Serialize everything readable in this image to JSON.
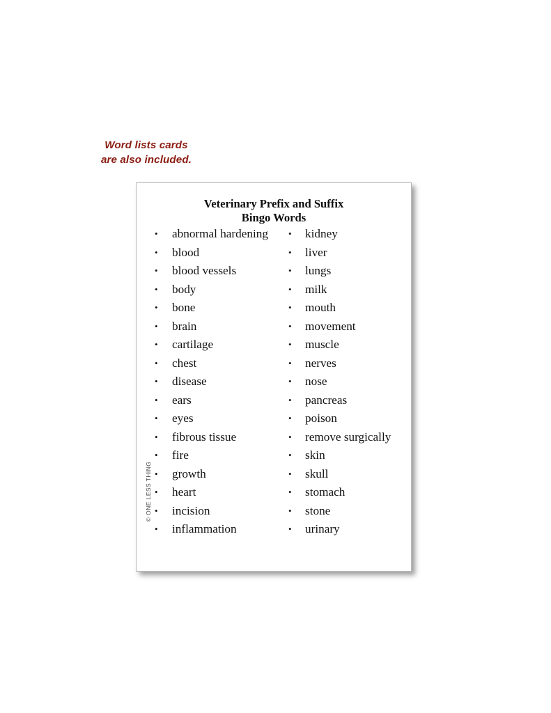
{
  "promo": {
    "lines": [
      "Word lists cards",
      "are also included."
    ],
    "color": "#8b1d13"
  },
  "card": {
    "title_lines": [
      "Veterinary Prefix and Suffix",
      "Bingo Words"
    ],
    "copyright": "© ONE LESS THING",
    "border_color": "#b9b9b9",
    "background": "#ffffff",
    "text_color": "#121212",
    "columns": {
      "left": [
        "abnormal hardening",
        "blood",
        "blood vessels",
        "body",
        "bone",
        "brain",
        "cartilage",
        "chest",
        "disease",
        "ears",
        "eyes",
        "fibrous tissue",
        "fire",
        "growth",
        "heart",
        "incision",
        "inflammation"
      ],
      "right": [
        "kidney",
        "liver",
        "lungs",
        "milk",
        "mouth",
        "movement",
        "muscle",
        "nerves",
        "nose",
        "pancreas",
        "poison",
        "remove surgically",
        "skin",
        "skull",
        "stomach",
        "stone",
        "urinary"
      ]
    }
  }
}
